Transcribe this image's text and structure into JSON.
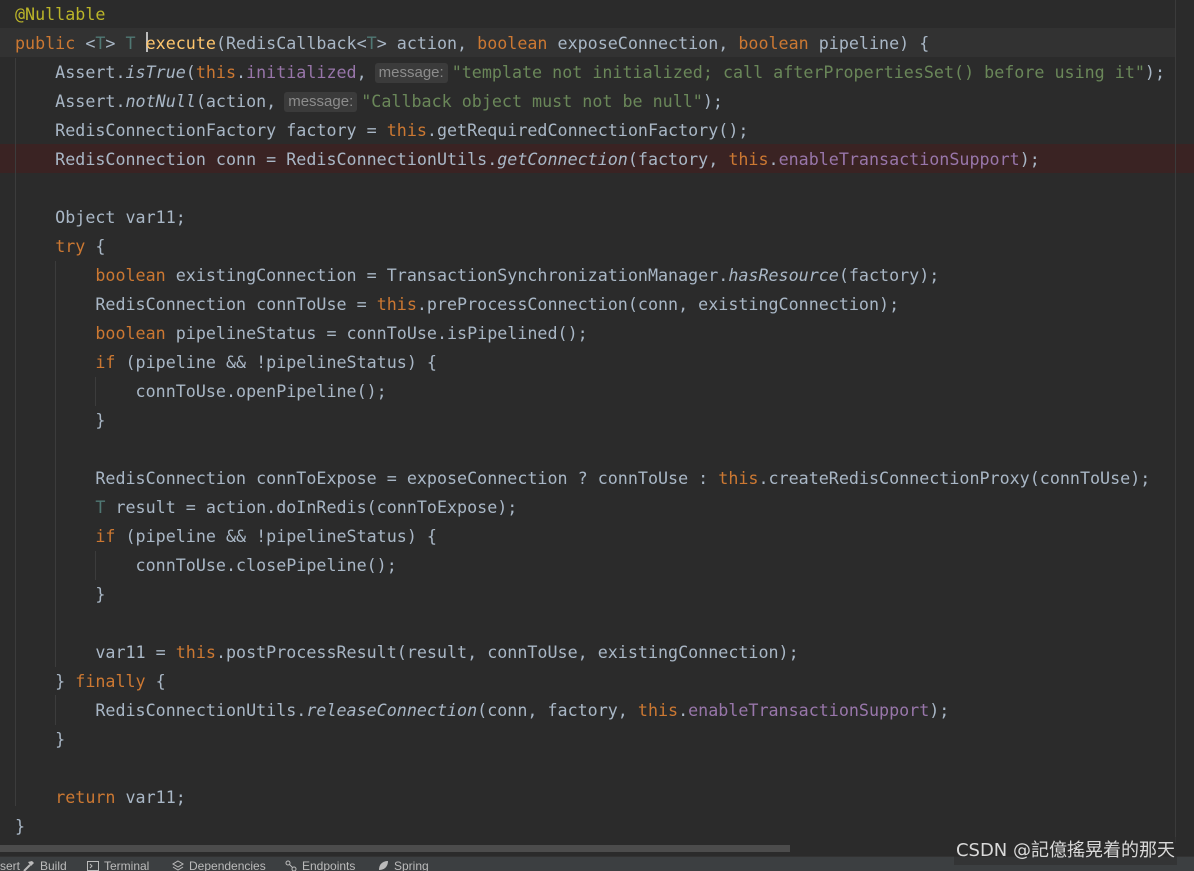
{
  "editor": {
    "lines": [
      [
        {
          "t": "@Nullable",
          "c": "ann"
        }
      ],
      [
        {
          "t": "public ",
          "c": "kw"
        },
        {
          "t": "<"
        },
        {
          "t": "T",
          "c": "tp"
        },
        {
          "t": "> "
        },
        {
          "t": "T ",
          "c": "tp"
        },
        {
          "caret": true
        },
        {
          "t": "execute",
          "c": "fn"
        },
        {
          "t": "(RedisCallback<"
        },
        {
          "t": "T",
          "c": "tp"
        },
        {
          "t": "> action, "
        },
        {
          "t": "boolean ",
          "c": "kw"
        },
        {
          "t": "exposeConnection, "
        },
        {
          "t": "boolean ",
          "c": "kw"
        },
        {
          "t": "pipeline) {"
        }
      ],
      [
        {
          "t": "    Assert."
        },
        {
          "t": "isTrue",
          "c": "it"
        },
        {
          "t": "("
        },
        {
          "t": "this",
          "c": "kw"
        },
        {
          "t": "."
        },
        {
          "t": "initialized",
          "c": "fld"
        },
        {
          "t": ","
        },
        {
          "hint": "message:"
        },
        {
          "t": "\"template not initialized; call afterPropertiesSet() before using it\"",
          "c": "st"
        },
        {
          "t": ");"
        }
      ],
      [
        {
          "t": "    Assert."
        },
        {
          "t": "notNull",
          "c": "it"
        },
        {
          "t": "(action,"
        },
        {
          "hint": "message:"
        },
        {
          "t": "\"Callback object must not be null\"",
          "c": "st"
        },
        {
          "t": ");"
        }
      ],
      [
        {
          "t": "    RedisConnectionFactory factory = "
        },
        {
          "t": "this",
          "c": "kw"
        },
        {
          "t": ".getRequiredConnectionFactory();"
        }
      ],
      [
        {
          "t": "    RedisConnection conn = RedisConnectionUtils."
        },
        {
          "t": "getConnection",
          "c": "it"
        },
        {
          "t": "(factory, "
        },
        {
          "t": "this",
          "c": "kw"
        },
        {
          "t": "."
        },
        {
          "t": "enableTransactionSupport",
          "c": "fld"
        },
        {
          "t": ");"
        }
      ],
      [],
      [
        {
          "t": "    Object var11;"
        }
      ],
      [
        {
          "t": "    "
        },
        {
          "t": "try",
          "c": "kw"
        },
        {
          "t": " {"
        }
      ],
      [
        {
          "t": "        "
        },
        {
          "t": "boolean",
          "c": "kw"
        },
        {
          "t": " existingConnection = TransactionSynchronizationManager."
        },
        {
          "t": "hasResource",
          "c": "it"
        },
        {
          "t": "(factory);"
        }
      ],
      [
        {
          "t": "        RedisConnection connToUse = "
        },
        {
          "t": "this",
          "c": "kw"
        },
        {
          "t": ".preProcessConnection(conn, existingConnection);"
        }
      ],
      [
        {
          "t": "        "
        },
        {
          "t": "boolean",
          "c": "kw"
        },
        {
          "t": " pipelineStatus = connToUse.isPipelined();"
        }
      ],
      [
        {
          "t": "        "
        },
        {
          "t": "if",
          "c": "kw"
        },
        {
          "t": " (pipeline && !pipelineStatus) {"
        }
      ],
      [
        {
          "t": "            connToUse.openPipeline();"
        }
      ],
      [
        {
          "t": "        }"
        }
      ],
      [],
      [
        {
          "t": "        RedisConnection connToExpose = exposeConnection ? connToUse : "
        },
        {
          "t": "this",
          "c": "kw"
        },
        {
          "t": ".createRedisConnectionProxy(connToUse);"
        }
      ],
      [
        {
          "t": "        "
        },
        {
          "t": "T",
          "c": "tp"
        },
        {
          "t": " result = action.doInRedis(connToExpose);"
        }
      ],
      [
        {
          "t": "        "
        },
        {
          "t": "if",
          "c": "kw"
        },
        {
          "t": " (pipeline && !pipelineStatus) {"
        }
      ],
      [
        {
          "t": "            connToUse.closePipeline();"
        }
      ],
      [
        {
          "t": "        }"
        }
      ],
      [],
      [
        {
          "t": "        var11 = "
        },
        {
          "t": "this",
          "c": "kw"
        },
        {
          "t": ".postProcessResult(result, connToUse, existingConnection);"
        }
      ],
      [
        {
          "t": "    } "
        },
        {
          "t": "finally",
          "c": "kw"
        },
        {
          "t": " {"
        }
      ],
      [
        {
          "t": "        RedisConnectionUtils."
        },
        {
          "t": "releaseConnection",
          "c": "it"
        },
        {
          "t": "(conn, factory, "
        },
        {
          "t": "this",
          "c": "kw"
        },
        {
          "t": "."
        },
        {
          "t": "enableTransactionSupport",
          "c": "fld"
        },
        {
          "t": ");"
        }
      ],
      [
        {
          "t": "    }"
        }
      ],
      [],
      [
        {
          "t": "    "
        },
        {
          "t": "return",
          "c": "kw"
        },
        {
          "t": " var11;"
        }
      ],
      [
        {
          "t": "}"
        }
      ]
    ]
  },
  "colors": {
    "background": "#2b2b2b",
    "keyword": "#cc7832",
    "annotation": "#bbb529",
    "type_param": "#507874",
    "method_decl": "#ffc66d",
    "string": "#6a8759",
    "field": "#9876aa",
    "default_text": "#a9b7c6",
    "breakpoint_line": "#3a2323"
  },
  "watermark": "CSDN @記億搖晃着的那天",
  "toolwindows": [
    {
      "label": "ssert",
      "icon": "none"
    },
    {
      "label": "Build",
      "icon": "hammer-icon"
    },
    {
      "label": "Terminal",
      "icon": "terminal-icon"
    },
    {
      "label": "Dependencies",
      "icon": "layers-icon"
    },
    {
      "label": "Endpoints",
      "icon": "endpoints-icon"
    },
    {
      "label": "Spring",
      "icon": "spring-leaf-icon"
    }
  ]
}
